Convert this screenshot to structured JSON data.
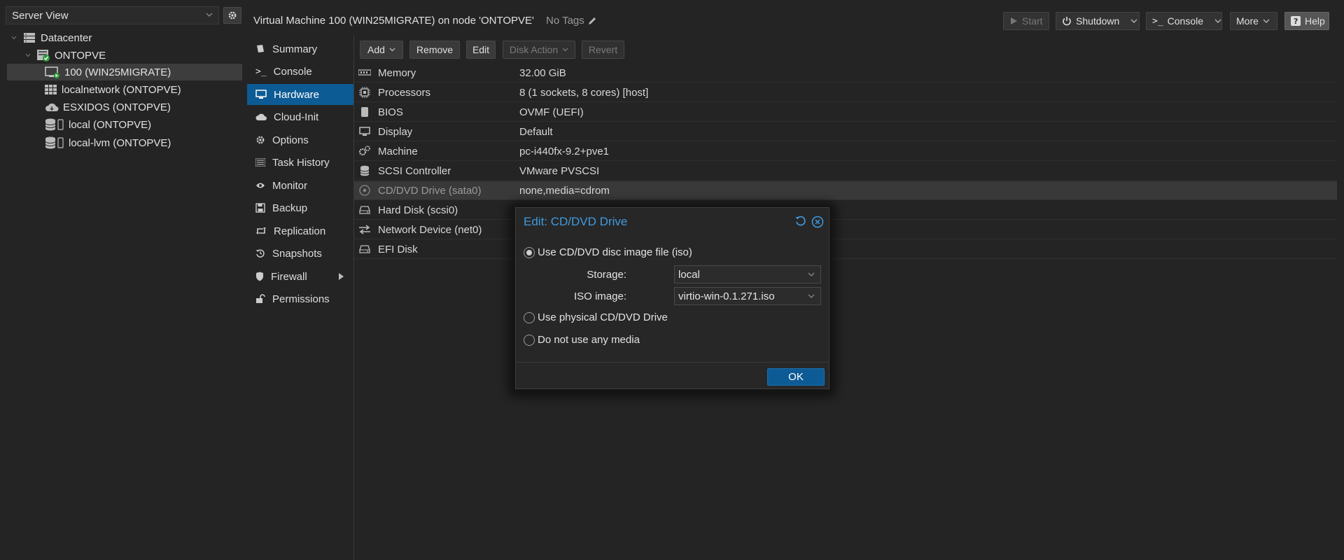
{
  "left": {
    "view_select": "Server View",
    "tree": [
      {
        "label": "Datacenter"
      },
      {
        "label": "ONTOPVE"
      },
      {
        "label": "100 (WIN25MIGRATE)"
      },
      {
        "label": "localnetwork (ONTOPVE)"
      },
      {
        "label": "ESXIDOS (ONTOPVE)"
      },
      {
        "label": "local (ONTOPVE)"
      },
      {
        "label": "local-lvm (ONTOPVE)"
      }
    ]
  },
  "header": {
    "title": "Virtual Machine 100 (WIN25MIGRATE) on node 'ONTOPVE'",
    "no_tags": "No Tags",
    "start": "Start",
    "shutdown": "Shutdown",
    "console": "Console",
    "more": "More",
    "help": "Help"
  },
  "nav": [
    {
      "label": "Summary",
      "icon": "book-icon"
    },
    {
      "label": "Console",
      "icon": "terminal-icon"
    },
    {
      "label": "Hardware",
      "icon": "monitor-icon"
    },
    {
      "label": "Cloud-Init",
      "icon": "cloud-icon"
    },
    {
      "label": "Options",
      "icon": "gear-icon"
    },
    {
      "label": "Task History",
      "icon": "list-icon"
    },
    {
      "label": "Monitor",
      "icon": "eye-icon"
    },
    {
      "label": "Backup",
      "icon": "floppy-icon"
    },
    {
      "label": "Replication",
      "icon": "retweet-icon"
    },
    {
      "label": "Snapshots",
      "icon": "history-icon"
    },
    {
      "label": "Firewall",
      "icon": "shield-icon"
    },
    {
      "label": "Permissions",
      "icon": "unlock-icon"
    }
  ],
  "toolbar": {
    "add": "Add",
    "remove": "Remove",
    "edit": "Edit",
    "disk_action": "Disk Action",
    "revert": "Revert"
  },
  "hardware": [
    {
      "key": "Memory",
      "value": "32.00 GiB",
      "icon": "memory-icon"
    },
    {
      "key": "Processors",
      "value": "8 (1 sockets, 8 cores) [host]",
      "icon": "cpu-icon"
    },
    {
      "key": "BIOS",
      "value": "OVMF (UEFI)",
      "icon": "chip-icon"
    },
    {
      "key": "Display",
      "value": "Default",
      "icon": "desktop-icon"
    },
    {
      "key": "Machine",
      "value": "pc-i440fx-9.2+pve1",
      "icon": "cogs-icon"
    },
    {
      "key": "SCSI Controller",
      "value": "VMware PVSCSI",
      "icon": "database-icon"
    },
    {
      "key": "CD/DVD Drive (sata0)",
      "value": "none,media=cdrom",
      "icon": "disc-icon"
    },
    {
      "key": "Hard Disk (scsi0)",
      "value": "",
      "icon": "hdd-icon"
    },
    {
      "key": "Network Device (net0)",
      "value": "",
      "icon": "exchange-icon"
    },
    {
      "key": "EFI Disk",
      "value": "",
      "icon": "hdd-icon"
    }
  ],
  "modal": {
    "title": "Edit: CD/DVD Drive",
    "option_iso": "Use CD/DVD disc image file (iso)",
    "storage_label": "Storage:",
    "storage_value": "local",
    "iso_label": "ISO image:",
    "iso_value": "virtio-win-0.1.271.iso",
    "option_physical": "Use physical CD/DVD Drive",
    "option_none": "Do not use any media",
    "ok": "OK"
  },
  "colors": {
    "accent": "#0d5b94",
    "title_blue": "#3f9be0",
    "background": "#242424"
  }
}
